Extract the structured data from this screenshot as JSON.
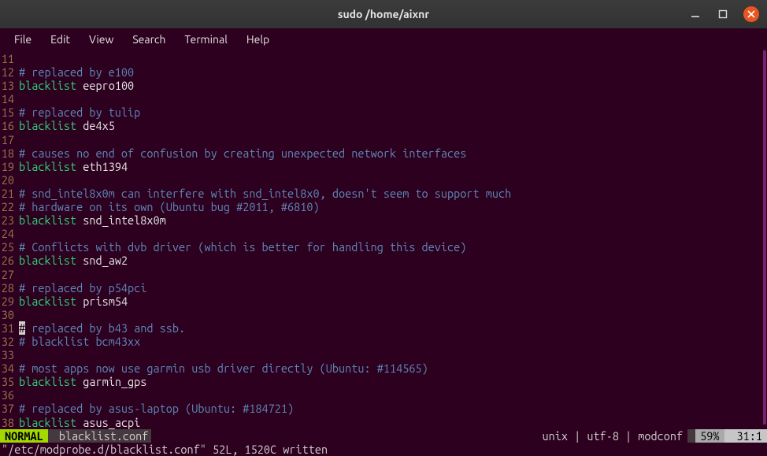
{
  "window": {
    "title": "sudo  /home/aixnr"
  },
  "menu": {
    "file": "File",
    "edit": "Edit",
    "view": "View",
    "search": "Search",
    "terminal": "Terminal",
    "help": "Help"
  },
  "lines": [
    {
      "n": "11",
      "type": "blank"
    },
    {
      "n": "12",
      "type": "comment",
      "text": "# replaced by e100"
    },
    {
      "n": "13",
      "type": "code",
      "kw": "blacklist",
      "id": "eepro100"
    },
    {
      "n": "14",
      "type": "blank"
    },
    {
      "n": "15",
      "type": "comment",
      "text": "# replaced by tulip"
    },
    {
      "n": "16",
      "type": "code",
      "kw": "blacklist",
      "id": "de4x5"
    },
    {
      "n": "17",
      "type": "blank"
    },
    {
      "n": "18",
      "type": "comment",
      "text": "# causes no end of confusion by creating unexpected network interfaces"
    },
    {
      "n": "19",
      "type": "code",
      "kw": "blacklist",
      "id": "eth1394"
    },
    {
      "n": "20",
      "type": "blank"
    },
    {
      "n": "21",
      "type": "comment",
      "text": "# snd_intel8x0m can interfere with snd_intel8x0, doesn't seem to support much"
    },
    {
      "n": "22",
      "type": "comment",
      "text": "# hardware on its own (Ubuntu bug #2011, #6810)"
    },
    {
      "n": "23",
      "type": "code",
      "kw": "blacklist",
      "id": "snd_intel8x0m"
    },
    {
      "n": "24",
      "type": "blank"
    },
    {
      "n": "25",
      "type": "comment",
      "text": "# Conflicts with dvb driver (which is better for handling this device)"
    },
    {
      "n": "26",
      "type": "code",
      "kw": "blacklist",
      "id": "snd_aw2"
    },
    {
      "n": "27",
      "type": "blank"
    },
    {
      "n": "28",
      "type": "comment",
      "text": "# replaced by p54pci"
    },
    {
      "n": "29",
      "type": "code",
      "kw": "blacklist",
      "id": "prism54"
    },
    {
      "n": "30",
      "type": "blank"
    },
    {
      "n": "31",
      "type": "comment-cursor",
      "cursor": "#",
      "rest": " replaced by b43 and ssb."
    },
    {
      "n": "32",
      "type": "comment",
      "text": "# blacklist bcm43xx"
    },
    {
      "n": "33",
      "type": "blank"
    },
    {
      "n": "34",
      "type": "comment",
      "text": "# most apps now use garmin usb driver directly (Ubuntu: #114565)"
    },
    {
      "n": "35",
      "type": "code",
      "kw": "blacklist",
      "id": "garmin_gps"
    },
    {
      "n": "36",
      "type": "blank"
    },
    {
      "n": "37",
      "type": "comment",
      "text": "# replaced by asus-laptop (Ubuntu: #184721)"
    },
    {
      "n": "38",
      "type": "code",
      "kw": "blacklist",
      "id": "asus_acpi"
    }
  ],
  "status": {
    "mode": "NORMAL",
    "filename": "blacklist.conf",
    "fileinfo": "unix | utf-8 | modconf",
    "percent": "59%",
    "position": "31:1"
  },
  "message": "\"/etc/modprobe.d/blacklist.conf\" 52L, 1520C written"
}
